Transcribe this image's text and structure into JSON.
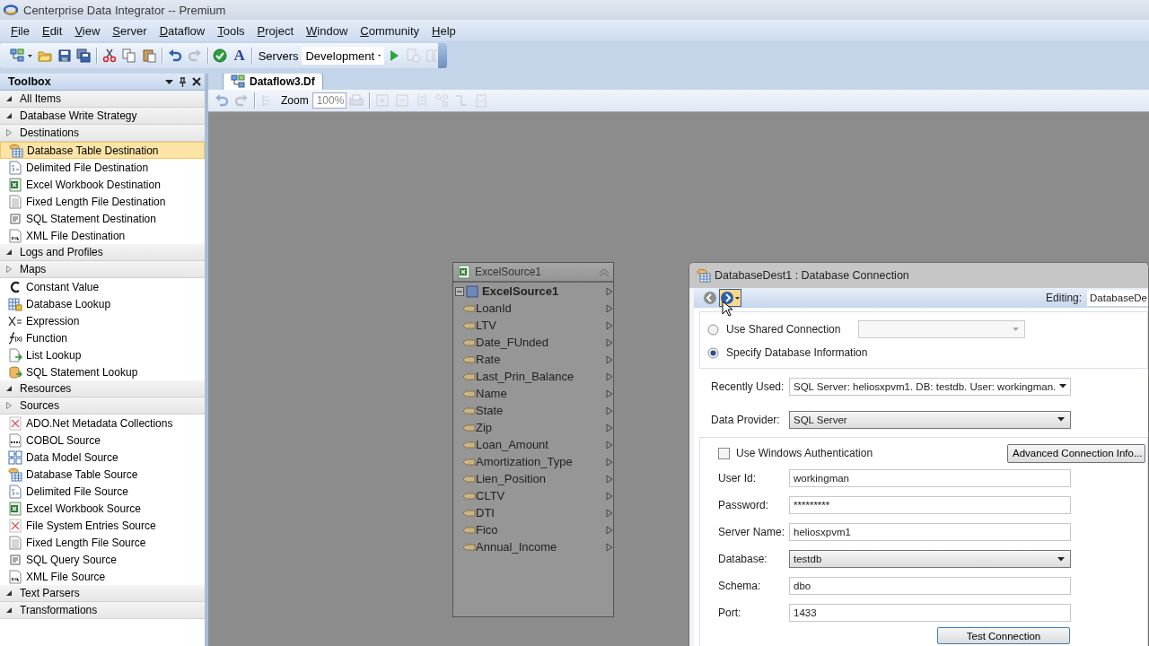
{
  "window": {
    "title": "Centerprise Data Integrator -- Premium"
  },
  "menu": [
    "File",
    "Edit",
    "View",
    "Server",
    "Dataflow",
    "Tools",
    "Project",
    "Window",
    "Community",
    "Help"
  ],
  "toolbar": [
    {
      "kind": "tool",
      "disabled": false
    },
    {
      "kind": "tool",
      "disabled": false
    },
    {
      "kind": "tool",
      "disabled": false
    },
    {
      "kind": "tool",
      "disabled": false
    },
    {
      "kind": "sep"
    },
    {
      "kind": "tool",
      "disabled": false
    },
    {
      "kind": "tool",
      "disabled": false
    },
    {
      "kind": "tool",
      "disabled": false
    },
    {
      "kind": "sep"
    },
    {
      "kind": "tool",
      "disabled": false
    },
    {
      "kind": "tool",
      "disabled": true
    },
    {
      "kind": "sep"
    },
    {
      "kind": "tool",
      "disabled": false
    },
    {
      "kind": "glyph",
      "text": "A"
    },
    {
      "kind": "sep"
    },
    {
      "kind": "label",
      "text": "Servers"
    },
    {
      "kind": "combo",
      "value": "Development"
    },
    {
      "kind": "tool",
      "disabled": false
    },
    {
      "kind": "tool",
      "disabled": true
    },
    {
      "kind": "tool",
      "disabled": true
    }
  ],
  "toolbox": {
    "title": "Toolbox",
    "groups": [
      {
        "label": "All Items",
        "expanded": true
      },
      {
        "label": "Database Write Strategy",
        "expanded": true
      },
      {
        "label": "Destinations",
        "expanded": false,
        "children": [
          {
            "label": "Database Table Destination",
            "selected": true
          },
          {
            "label": "Delimited File Destination",
            "selected": false
          },
          {
            "label": "Excel Workbook Destination",
            "selected": false
          },
          {
            "label": "Fixed Length File Destination",
            "selected": false
          },
          {
            "label": "SQL Statement Destination",
            "selected": false
          },
          {
            "label": "XML File Destination",
            "selected": false
          }
        ]
      },
      {
        "label": "Logs and Profiles",
        "expanded": true
      },
      {
        "label": "Maps",
        "expanded": false,
        "children": [
          {
            "label": "Constant Value",
            "selected": false
          },
          {
            "label": "Database Lookup",
            "selected": false
          },
          {
            "label": "Expression",
            "selected": false
          },
          {
            "label": "Function",
            "selected": false
          },
          {
            "label": "List Lookup",
            "selected": false
          },
          {
            "label": "SQL Statement Lookup",
            "selected": false
          }
        ]
      },
      {
        "label": "Resources",
        "expanded": true
      },
      {
        "label": "Sources",
        "expanded": false,
        "children": [
          {
            "label": "ADO.Net Metadata Collections",
            "selected": false
          },
          {
            "label": "COBOL Source",
            "selected": false
          },
          {
            "label": "Data Model Source",
            "selected": false
          },
          {
            "label": "Database Table Source",
            "selected": false
          },
          {
            "label": "Delimited File Source",
            "selected": false
          },
          {
            "label": "Excel Workbook Source",
            "selected": false
          },
          {
            "label": "File System Entries Source",
            "selected": false
          },
          {
            "label": "Fixed Length File Source",
            "selected": false
          },
          {
            "label": "SQL Query Source",
            "selected": false
          },
          {
            "label": "XML File Source",
            "selected": false
          }
        ]
      },
      {
        "label": "Text Parsers",
        "expanded": true
      },
      {
        "label": "Transformations",
        "expanded": true
      }
    ]
  },
  "document_tab": {
    "label": "Dataflow3.Df",
    "selected": true
  },
  "canvas_toolbar": [
    {
      "kind": "tool",
      "disabled": true
    },
    {
      "kind": "tool",
      "disabled": true
    },
    {
      "kind": "sep"
    },
    {
      "kind": "tool",
      "disabled": true
    },
    {
      "kind": "label",
      "text": "Zoom"
    },
    {
      "kind": "combo",
      "value": "100%"
    },
    {
      "kind": "tool",
      "disabled": true
    },
    {
      "kind": "sep"
    },
    {
      "kind": "tool",
      "disabled": true
    },
    {
      "kind": "tool",
      "disabled": true
    },
    {
      "kind": "tool",
      "disabled": true
    },
    {
      "kind": "tool",
      "disabled": true
    },
    {
      "kind": "tool",
      "disabled": true
    },
    {
      "kind": "tool",
      "disabled": true
    }
  ],
  "node": {
    "title": "ExcelSource1",
    "root": "ExcelSource1",
    "expanded": true,
    "fields": [
      "LoanId",
      "LTV",
      "Date_FUnded",
      "Rate",
      "Last_Prin_Balance",
      "Name",
      "State",
      "Zip",
      "Loan_Amount",
      "Amortization_Type",
      "Lien_Position",
      "CLTV",
      "DTI",
      "Fico",
      "Annual_Income"
    ]
  },
  "dialog": {
    "title": "DatabaseDest1 : Database Connection",
    "editing_label": "Editing:",
    "editing_value": "DatabaseDe",
    "connection_options": [
      {
        "label": "Use Shared Connection",
        "selected": false
      },
      {
        "label": "Specify Database Information",
        "selected": true
      }
    ],
    "recently_used": {
      "label": "Recently Used:",
      "value": "SQL Server:  heliosxpvm1. DB: testdb. User: workingman."
    },
    "data_provider": {
      "label": "Data Provider:",
      "value": "SQL Server"
    },
    "windows_auth": {
      "label": "Use Windows Authentication",
      "checked": false
    },
    "advanced_button": "Advanced Connection Info...",
    "fields": [
      {
        "label": "User Id:",
        "value": "workingman",
        "kind": "text"
      },
      {
        "label": "Password:",
        "value": "*********",
        "kind": "text"
      },
      {
        "label": "Server Name:",
        "value": "heliosxpvm1",
        "kind": "text"
      },
      {
        "label": "Database:",
        "value": "testdb",
        "kind": "combo"
      },
      {
        "label": "Schema:",
        "value": "dbo",
        "kind": "text"
      },
      {
        "label": "Port:",
        "value": "1433",
        "kind": "text"
      }
    ],
    "test_button": "Test Connection"
  }
}
